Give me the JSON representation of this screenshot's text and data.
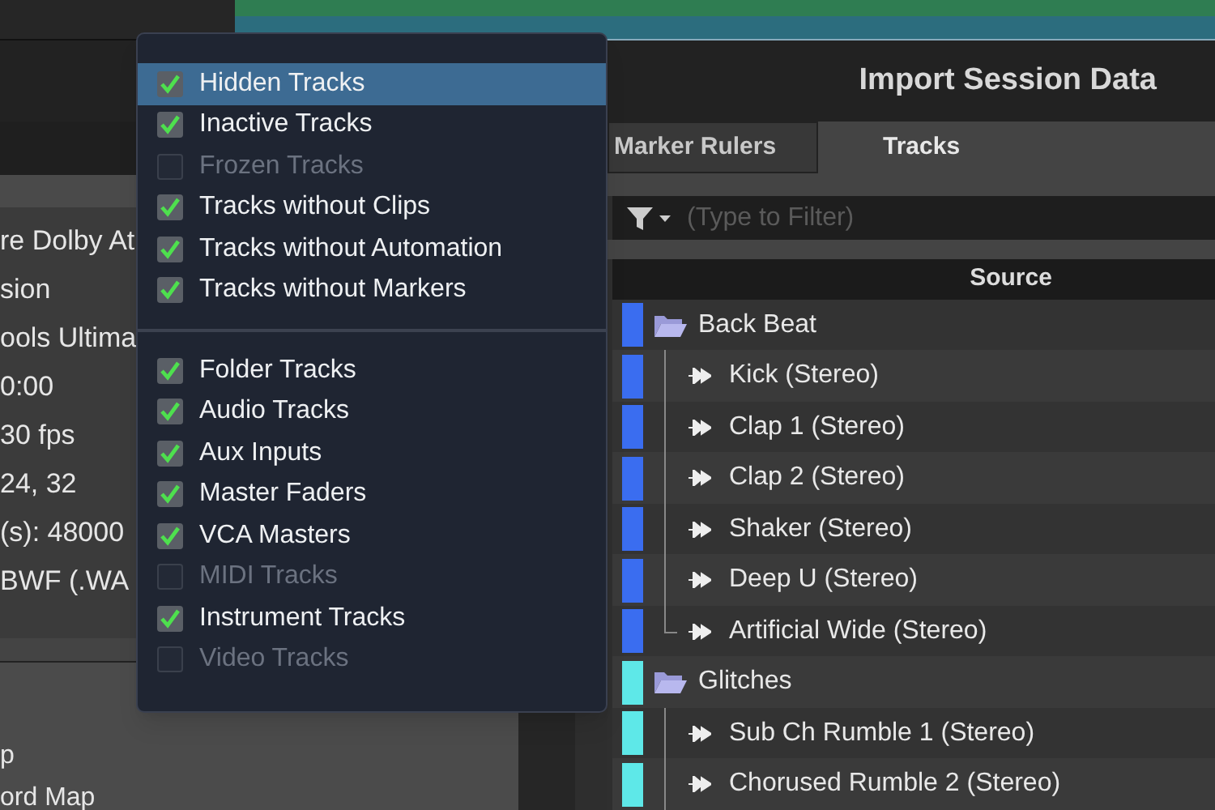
{
  "header": {
    "title": "Import Session Data"
  },
  "info_lines": [
    "re Dolby At",
    "sion",
    "ools Ultima",
    "0:00",
    "30 fps",
    "24, 32",
    "(s): 48000",
    "BWF (.WA"
  ],
  "bottom_lines": [
    "p",
    "ord Map"
  ],
  "tabs": [
    {
      "label": "Marker Rulers",
      "selected": false
    },
    {
      "label": "Tracks",
      "selected": true
    }
  ],
  "filter": {
    "placeholder": "(Type to Filter)"
  },
  "table": {
    "columns": [
      "Source"
    ],
    "rows": [
      {
        "kind": "folder",
        "name": "Back Beat",
        "color": "#3a6df0",
        "children": [
          {
            "kind": "track",
            "name": "Kick (Stereo)",
            "color": "#3a6df0"
          },
          {
            "kind": "track",
            "name": "Clap 1 (Stereo)",
            "color": "#3a6df0"
          },
          {
            "kind": "track",
            "name": "Clap 2 (Stereo)",
            "color": "#3a6df0"
          },
          {
            "kind": "track",
            "name": "Shaker (Stereo)",
            "color": "#3a6df0"
          },
          {
            "kind": "track",
            "name": "Deep U (Stereo)",
            "color": "#3a6df0"
          },
          {
            "kind": "track",
            "name": "Artificial Wide (Stereo)",
            "color": "#3a6df0"
          }
        ]
      },
      {
        "kind": "folder",
        "name": "Glitches",
        "color": "#5ee8e8",
        "children": [
          {
            "kind": "track",
            "name": "Sub Ch Rumble 1 (Stereo)",
            "color": "#5ee8e8"
          },
          {
            "kind": "track",
            "name": "Chorused Rumble 2 (Stereo)",
            "color": "#5ee8e8"
          }
        ]
      }
    ]
  },
  "menu": {
    "groups": [
      [
        {
          "label": "Hidden Tracks",
          "checked": true,
          "disabled": false,
          "selected": true
        },
        {
          "label": "Inactive Tracks",
          "checked": true,
          "disabled": false,
          "selected": false
        },
        {
          "label": "Frozen Tracks",
          "checked": false,
          "disabled": true,
          "selected": false
        },
        {
          "label": "Tracks without Clips",
          "checked": true,
          "disabled": false,
          "selected": false
        },
        {
          "label": "Tracks without Automation",
          "checked": true,
          "disabled": false,
          "selected": false
        },
        {
          "label": "Tracks without Markers",
          "checked": true,
          "disabled": false,
          "selected": false
        }
      ],
      [
        {
          "label": "Folder Tracks",
          "checked": true,
          "disabled": false,
          "selected": false
        },
        {
          "label": "Audio Tracks",
          "checked": true,
          "disabled": false,
          "selected": false
        },
        {
          "label": "Aux Inputs",
          "checked": true,
          "disabled": false,
          "selected": false
        },
        {
          "label": "Master Faders",
          "checked": true,
          "disabled": false,
          "selected": false
        },
        {
          "label": "VCA Masters",
          "checked": true,
          "disabled": false,
          "selected": false
        },
        {
          "label": "MIDI Tracks",
          "checked": false,
          "disabled": true,
          "selected": false
        },
        {
          "label": "Instrument Tracks",
          "checked": true,
          "disabled": false,
          "selected": false
        },
        {
          "label": "Video Tracks",
          "checked": false,
          "disabled": true,
          "selected": false
        }
      ]
    ]
  }
}
